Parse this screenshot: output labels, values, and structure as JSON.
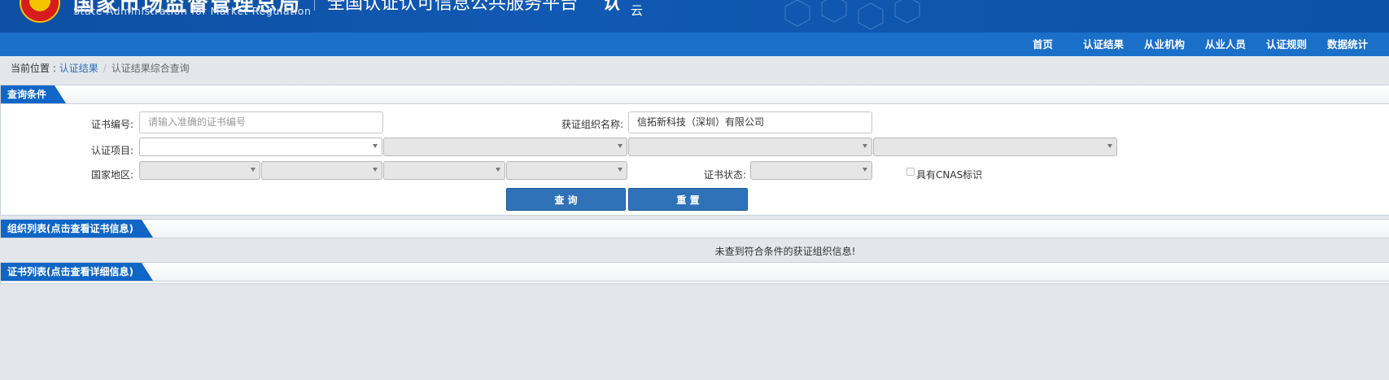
{
  "header": {
    "org_cn": "国家市场监督管理总局",
    "org_en": "State Administration  for  Market Regulation",
    "platform_title": "全国认证认可信息公共服务平台",
    "logo_mark": "认",
    "logo_sub": "云",
    "brand_colors": {
      "header_blue": "#0e4fa3",
      "nav_blue": "#1a6fc9",
      "button_blue": "#2f72b8"
    }
  },
  "nav": {
    "items": [
      {
        "label": "首页"
      },
      {
        "label": "认证结果"
      },
      {
        "label": "从业机构"
      },
      {
        "label": "从业人员"
      },
      {
        "label": "认证规则"
      },
      {
        "label": "数据统计"
      }
    ]
  },
  "breadcrumb": {
    "prefix": "当前位置 : ",
    "link": "认证结果",
    "separator": "/",
    "current": "认证结果综合查询"
  },
  "query_panel": {
    "title": "查询条件",
    "cert_no": {
      "label": "证书编号:",
      "value": "",
      "placeholder": "请输入准确的证书编号"
    },
    "org_name": {
      "label": "获证组织名称:",
      "value": "信拓新科技（深圳）有限公司"
    },
    "cert_item": {
      "label": "认证项目:"
    },
    "region": {
      "label": "国家地区:"
    },
    "cert_status": {
      "label": "证书状态:"
    },
    "cnas": {
      "label": "具有CNAS标识",
      "checked": false
    },
    "search_button": "查 询",
    "reset_button": "重 置"
  },
  "org_list": {
    "title": "组织列表(点击查看证书信息)",
    "empty_message": "未查到符合条件的获证组织信息!"
  },
  "cert_list": {
    "title": "证书列表(点击查看详细信息)"
  }
}
